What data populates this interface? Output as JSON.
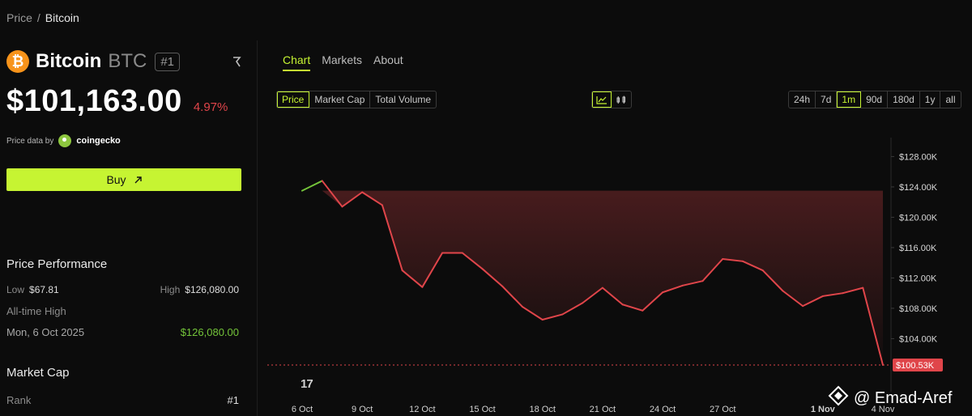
{
  "breadcrumb": {
    "root": "Price",
    "separator": "/",
    "current": "Bitcoin"
  },
  "coin": {
    "icon": "bitcoin-icon",
    "name": "Bitcoin",
    "symbol": "BTC",
    "rank_badge": "#1",
    "price": "$101,163.00",
    "change": "4.97%",
    "brand_color": "#f7931a"
  },
  "source": {
    "label": "Price data by",
    "name": "coingecko"
  },
  "buy": {
    "label": "Buy",
    "icon": "arrow-up-right-icon"
  },
  "performance": {
    "title": "Price Performance",
    "low_label": "Low",
    "low_value": "$67.81",
    "high_label": "High",
    "high_value": "$126,080.00",
    "ath_label": "All-time High",
    "ath_date": "Mon, 6 Oct 2025",
    "ath_value": "$126,080.00"
  },
  "market_cap": {
    "title": "Market Cap",
    "rank_label": "Rank",
    "rank_value": "#1"
  },
  "tabs": [
    {
      "label": "Chart",
      "active": true
    },
    {
      "label": "Markets",
      "active": false
    },
    {
      "label": "About",
      "active": false
    }
  ],
  "metrics": [
    {
      "label": "Price",
      "active": true
    },
    {
      "label": "Market Cap",
      "active": false
    },
    {
      "label": "Total Volume",
      "active": false
    }
  ],
  "chart_types": [
    {
      "icon": "line-chart-icon",
      "active": true
    },
    {
      "icon": "candlestick-icon",
      "active": false
    }
  ],
  "ranges": [
    {
      "label": "24h",
      "active": false
    },
    {
      "label": "7d",
      "active": false
    },
    {
      "label": "1m",
      "active": true
    },
    {
      "label": "90d",
      "active": false
    },
    {
      "label": "180d",
      "active": false
    },
    {
      "label": "1y",
      "active": false
    },
    {
      "label": "all",
      "active": false
    }
  ],
  "colors": {
    "accent": "#c6f432",
    "down": "#e0454a",
    "up": "#74c43a"
  },
  "watermark": "@ Emad-Aref",
  "chart_data": {
    "type": "line",
    "x": [
      "6 Oct",
      "7 Oct",
      "8 Oct",
      "9 Oct",
      "10 Oct",
      "11 Oct",
      "12 Oct",
      "13 Oct",
      "14 Oct",
      "15 Oct",
      "16 Oct",
      "17 Oct",
      "18 Oct",
      "19 Oct",
      "20 Oct",
      "21 Oct",
      "22 Oct",
      "23 Oct",
      "24 Oct",
      "25 Oct",
      "26 Oct",
      "27 Oct",
      "28 Oct",
      "29 Oct",
      "30 Oct",
      "31 Oct",
      "1 Nov",
      "2 Nov",
      "3 Nov",
      "4 Nov"
    ],
    "values": [
      123500,
      124800,
      121400,
      123300,
      121600,
      113000,
      110800,
      115300,
      115300,
      113200,
      110900,
      108200,
      106500,
      107200,
      108700,
      110700,
      108500,
      107700,
      110100,
      111000,
      111600,
      114500,
      114200,
      113000,
      110300,
      108300,
      109600,
      110000,
      110700,
      100530
    ],
    "x_tick_labels": [
      "6 Oct",
      "9 Oct",
      "12 Oct",
      "15 Oct",
      "18 Oct",
      "21 Oct",
      "24 Oct",
      "27 Oct",
      "1 Nov",
      "4 Nov"
    ],
    "y_tick_labels": [
      "$128.00K",
      "$124.00K",
      "$120.00K",
      "$116.00K",
      "$112.00K",
      "$108.00K",
      "$104.00K"
    ],
    "ylim": [
      98500,
      130500
    ],
    "current_label": "$100.53K",
    "reference_value": 123500,
    "grid": false,
    "y_axis_side": "right"
  }
}
